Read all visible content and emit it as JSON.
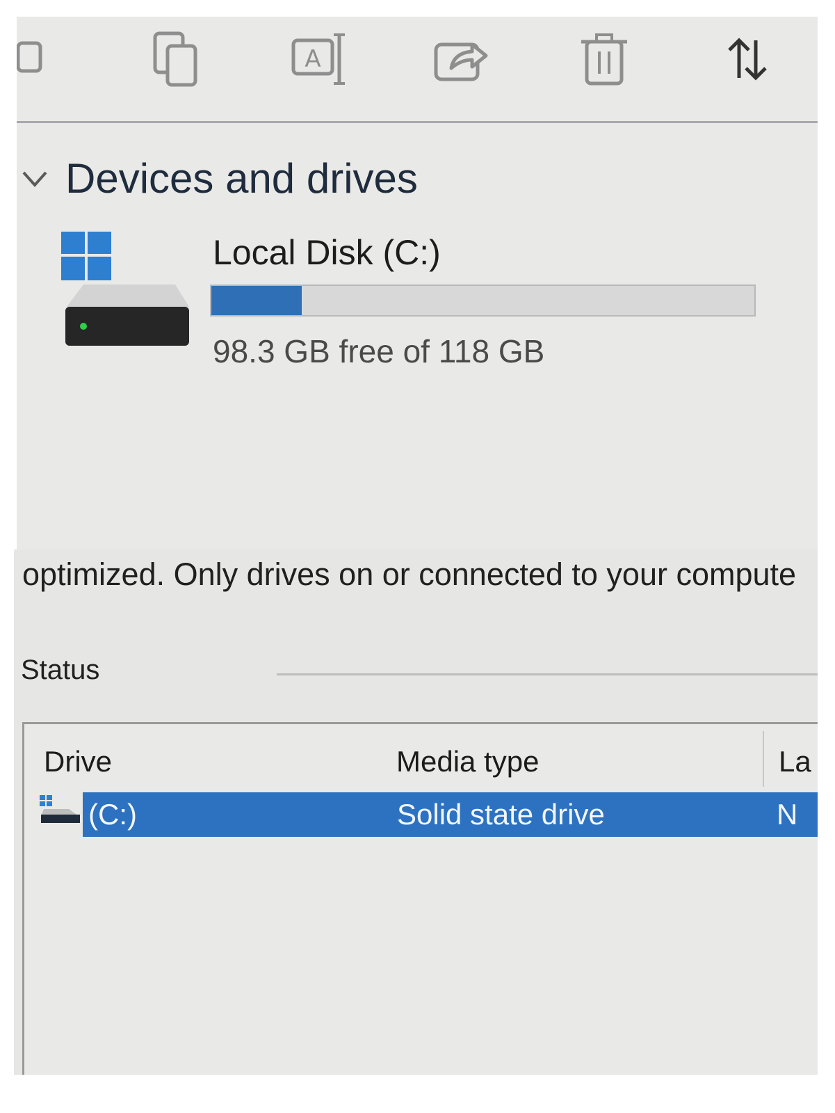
{
  "toolbar": {
    "buttons": [
      {
        "name": "cut-icon"
      },
      {
        "name": "copy-icon"
      },
      {
        "name": "rename-icon"
      },
      {
        "name": "share-icon"
      },
      {
        "name": "delete-icon"
      },
      {
        "name": "sort-icon"
      }
    ]
  },
  "section": {
    "title": "Devices and drives"
  },
  "drive": {
    "name": "Local Disk (C:)",
    "free_text": "98.3 GB free of 118 GB",
    "used_fraction": 0.167,
    "bar_color": "#2f6fb6"
  },
  "optimize": {
    "intro_text": "optimized. Only drives on or connected to your compute",
    "status_label": "Status",
    "columns": [
      "Drive",
      "Media type",
      "La"
    ],
    "rows": [
      {
        "drive": "(C:)",
        "media_type": "Solid state drive",
        "last": "N"
      }
    ],
    "selection_color": "#2d72c0"
  }
}
